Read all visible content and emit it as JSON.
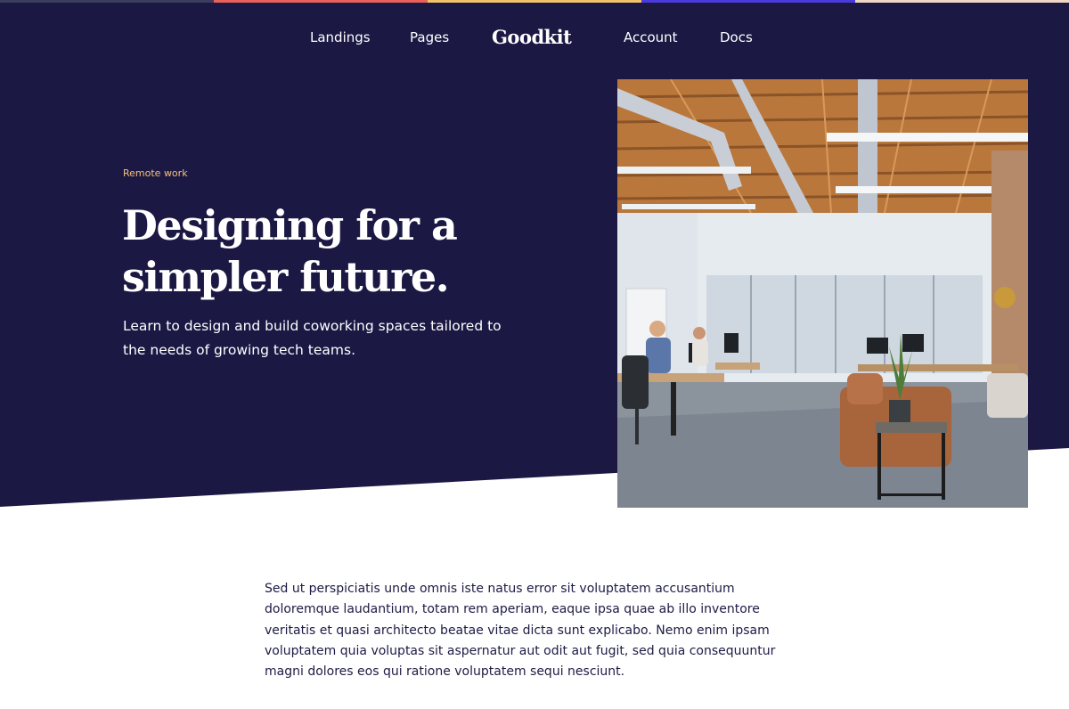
{
  "colors": {
    "hero_bg": "#1b1844",
    "accent": "#f6c177",
    "text_on_dark": "#ffffff",
    "body_text": "#1d1b44",
    "top_stripe": [
      "#3b3e5c",
      "#e8615a",
      "#f2c36b",
      "#4c3bdc",
      "#f0d7c5"
    ]
  },
  "nav": {
    "items": [
      "Landings",
      "Pages",
      "Account",
      "Docs"
    ],
    "brand": "Goodkit"
  },
  "hero": {
    "eyebrow": "Remote work",
    "title_line1": "Designing for a",
    "title_line2": "simpler future.",
    "subtitle": "Learn to design and build coworking spaces tailored to the needs of growing tech teams.",
    "image": "coworking-office-photo"
  },
  "article": {
    "paragraph": "Sed ut perspiciatis unde omnis iste natus error sit voluptatem accusantium doloremque laudantium, totam rem aperiam, eaque ipsa quae ab illo inventore veritatis et quasi architecto beatae vitae dicta sunt explicabo. Nemo enim ipsam voluptatem quia voluptas sit aspernatur aut odit aut fugit, sed quia consequuntur magni dolores eos qui ratione voluptatem sequi nesciunt."
  }
}
